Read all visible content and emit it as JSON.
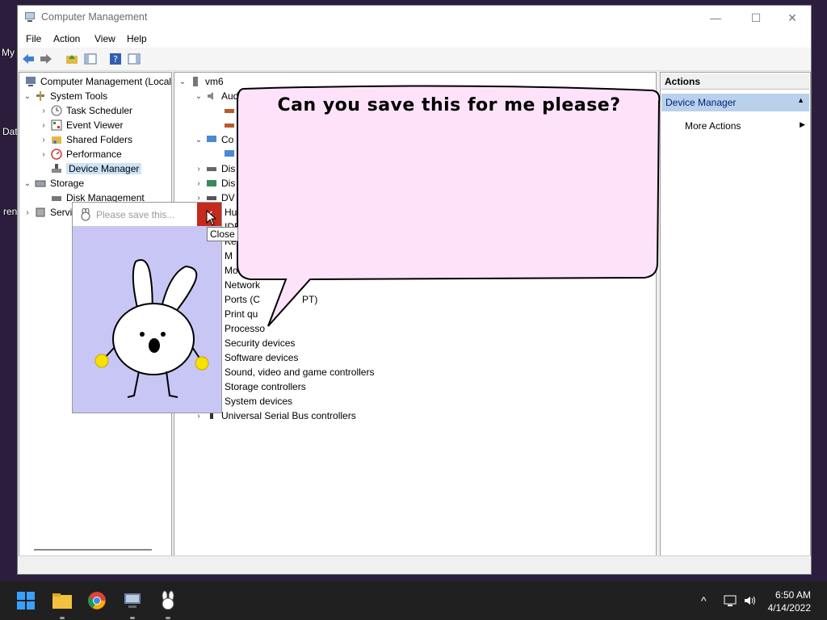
{
  "desktop": {
    "items": [
      "My",
      "Dat",
      "ren"
    ]
  },
  "window": {
    "title": "Computer Management",
    "controls": {
      "minimize": "—",
      "maximize": "☐",
      "close": "✕"
    }
  },
  "menu": [
    "File",
    "Action",
    "View",
    "Help"
  ],
  "left_tree": {
    "root": "Computer Management (Local",
    "items": [
      {
        "label": "System Tools"
      },
      {
        "label": "Task Scheduler"
      },
      {
        "label": "Event Viewer"
      },
      {
        "label": "Shared Folders"
      },
      {
        "label": "Performance"
      },
      {
        "label": "Device Manager"
      },
      {
        "label": "Storage"
      },
      {
        "label": "Disk Management"
      },
      {
        "label": "Servi"
      }
    ]
  },
  "center_tree": {
    "root": "vm6",
    "items": [
      "Aud",
      "Co",
      "Dis",
      "Dis",
      "DV",
      "Hu",
      "IDE",
      "Ke",
      "M",
      "Mo",
      "Network",
      "Ports (C",
      "PT)",
      "Print qu",
      "Processo",
      "Security devices",
      "Software devices",
      "Sound, video and game controllers",
      "Storage controllers",
      "System devices",
      "Universal Serial Bus controllers"
    ]
  },
  "actions": {
    "header": "Actions",
    "section": "Device Manager",
    "more": "More Actions"
  },
  "popup": {
    "title": "Please save this...",
    "close_tooltip": "Close"
  },
  "bubble": {
    "text": "Can you save this for me please?"
  },
  "taskbar": {
    "time": "6:50 AM",
    "date": "4/14/2022"
  },
  "colors": {
    "bubble_fill": "#fde2fa",
    "popup_bg": "#c8c6f5",
    "close_red": "#c42b1c",
    "selection": "#cde3f7",
    "actions_band": "#b9d1ea"
  }
}
